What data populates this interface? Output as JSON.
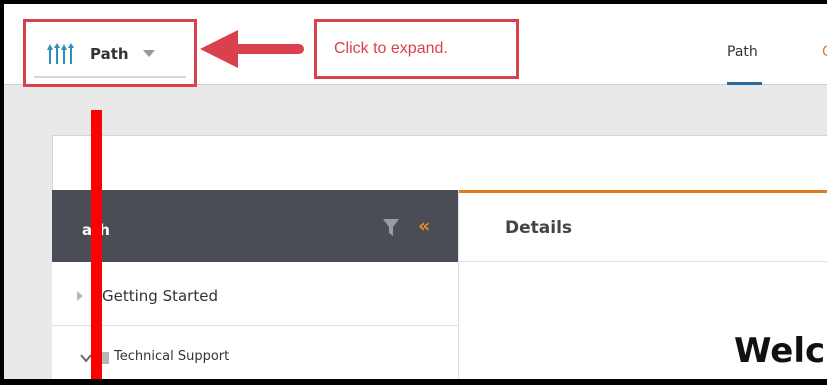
{
  "header": {
    "selector_label": "Path",
    "tabs": [
      {
        "label": "Path",
        "active": true
      },
      {
        "label": "C",
        "active": false
      }
    ]
  },
  "annotation": {
    "text": "Click to expand.",
    "color": "#d9414c"
  },
  "panel": {
    "title": "Path",
    "title_visible": "ath",
    "items": [
      {
        "label": "Getting Started",
        "state": "collapsed"
      },
      {
        "label": "Technical Support",
        "state": "expanded"
      }
    ]
  },
  "details": {
    "title": "Details",
    "welcome_text": "Welc"
  },
  "colors": {
    "accent_orange": "#e07a1f",
    "panel_dark": "#4a4d55",
    "active_tab_blue": "#2a6aa5",
    "marker_red": "#ff0000"
  }
}
